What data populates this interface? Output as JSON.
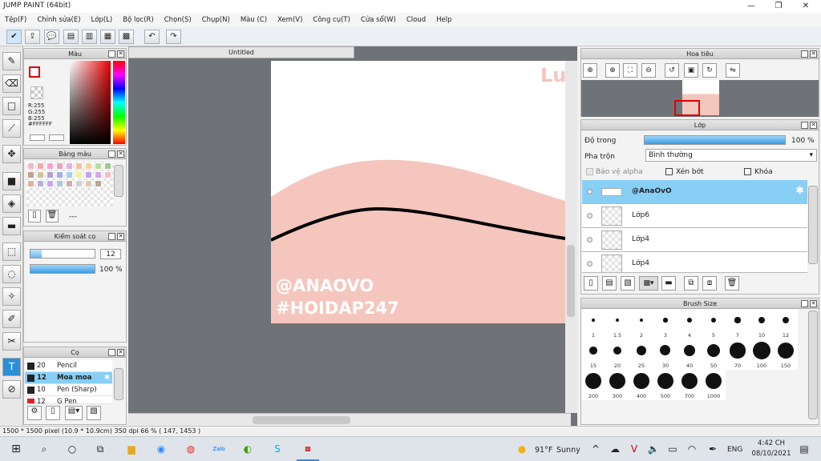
{
  "window": {
    "title": "JUMP PAINT (64bit)",
    "minimize": "—",
    "maximize": "❐",
    "close": "✕"
  },
  "menu": [
    "Tệp(F)",
    "Chỉnh sửa(E)",
    "Lớp(L)",
    "Bộ lọc(R)",
    "Chọn(S)",
    "Chụp(N)",
    "Màu (C)",
    "Xem(V)",
    "Công cụ(T)",
    "Cửa sổ(W)",
    "Cloud",
    "Help"
  ],
  "color_panel": {
    "title": "Màu",
    "r": "R:255",
    "g": "G:255",
    "b": "B:255",
    "hex": "#FFFFFF"
  },
  "palette_panel": {
    "title": "Bảng màu",
    "label": "---",
    "colors": [
      "#f7b6c9",
      "#f9a8a8",
      "#f8a0d0",
      "#f0a0c0",
      "#e8b0e0",
      "#f6c0a0",
      "#f8d0a0",
      "#b8e0a0",
      "#a0c890",
      "#c0a090",
      "#d0c0a0",
      "#b0a0d0",
      "#a0b0e0",
      "#a0d0f0",
      "#f0f0a0",
      "#c0a0f0",
      "#d0a8e8",
      "#f0c0c0",
      "#e0b0a0",
      "#b8b0d8",
      "#c8a8f0",
      "#a8c8e8",
      "#c8b0a8",
      "#d0d0d0",
      "#e0c8b8",
      "#b8a890"
    ]
  },
  "brush_control": {
    "title": "Kiểm soát cọ",
    "size": "12",
    "opacity": "100 %",
    "size_fill": 0.18,
    "opacity_fill": 1.0
  },
  "brush_panel": {
    "title": "Cọ",
    "items": [
      {
        "size": "20",
        "name": "Pencil",
        "color": "#222222"
      },
      {
        "size": "12",
        "name": "Moa moa",
        "color": "#222222",
        "selected": true
      },
      {
        "size": "10",
        "name": "Pen (Sharp)",
        "color": "#222222"
      },
      {
        "size": "12",
        "name": "G Pen",
        "color": "#e02020"
      }
    ]
  },
  "document": {
    "tab": "Untitled",
    "text1": "@ANAOVO",
    "text2": "#HOIDAP247",
    "corner_mark": "Lu"
  },
  "navigator": {
    "title": "Hoa tiêu"
  },
  "layer_panel": {
    "title": "Lớp",
    "opacity_label": "Độ trong",
    "opacity_value": "100 %",
    "blend_label": "Pha trộn",
    "blend_value": "Bình thường",
    "protect_alpha": "Bảo vệ alpha",
    "clip": "Xén bớt",
    "lock": "Khóa",
    "layers": [
      {
        "name": "@AnaOvO",
        "selected": true
      },
      {
        "name": "Lớp6"
      },
      {
        "name": "Lớp4"
      },
      {
        "name": "Lớp4"
      }
    ]
  },
  "brush_size": {
    "title": "Brush Size",
    "sizes": [
      "1",
      "1.5",
      "2",
      "3",
      "4",
      "5",
      "7",
      "10",
      "12",
      "15",
      "20",
      "25",
      "30",
      "40",
      "50",
      "70",
      "100",
      "150",
      "200",
      "300",
      "400",
      "500",
      "700",
      "1000"
    ]
  },
  "status": {
    "text": "1500 * 1500 pixel   (10.9 * 10.9cm)   350 dpi   66 %   ( 147, 1453 )"
  },
  "taskbar": {
    "weather_temp": "91°F",
    "weather_text": "Sunny",
    "lang": "ENG",
    "time": "4:42 CH",
    "date": "08/10/2021"
  },
  "colors": {
    "pink": "#f5c6bd",
    "selected_blue": "#88cff6",
    "accent": "#3aa0e8"
  }
}
